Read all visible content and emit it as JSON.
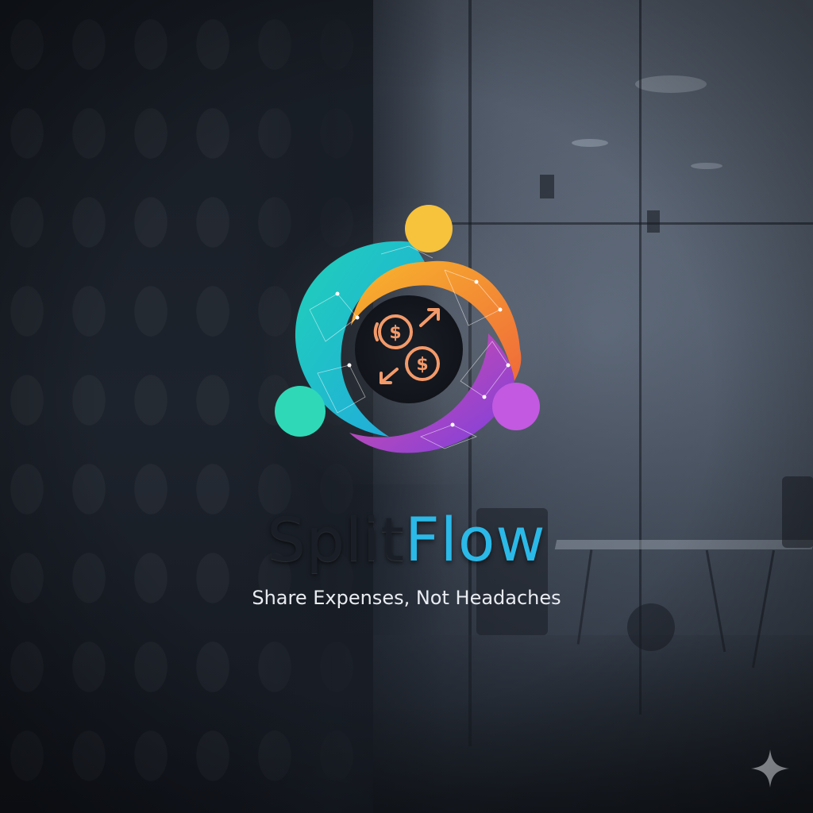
{
  "brand": {
    "name_part1": "Split",
    "name_part2": "Flow",
    "tagline": "Share Expenses, Not Headaches",
    "colors": {
      "name_part1": "#1a1f27",
      "name_part2": "#2bb9e8",
      "tagline": "#e8ecf1"
    }
  },
  "logo": {
    "icon": "currency-exchange-icon",
    "ring_colors": [
      "#1fd1b8",
      "#22a7e0",
      "#f59a1b",
      "#f06a3a",
      "#e14fa0",
      "#a14be0"
    ],
    "people_dot_colors": [
      "#f7c23c",
      "#2fd9b7",
      "#c259e0"
    ],
    "symbol_color": "#f39a6a"
  },
  "background": {
    "scene": "glass-office-wall"
  },
  "watermark": {
    "icon": "sparkle-icon"
  }
}
